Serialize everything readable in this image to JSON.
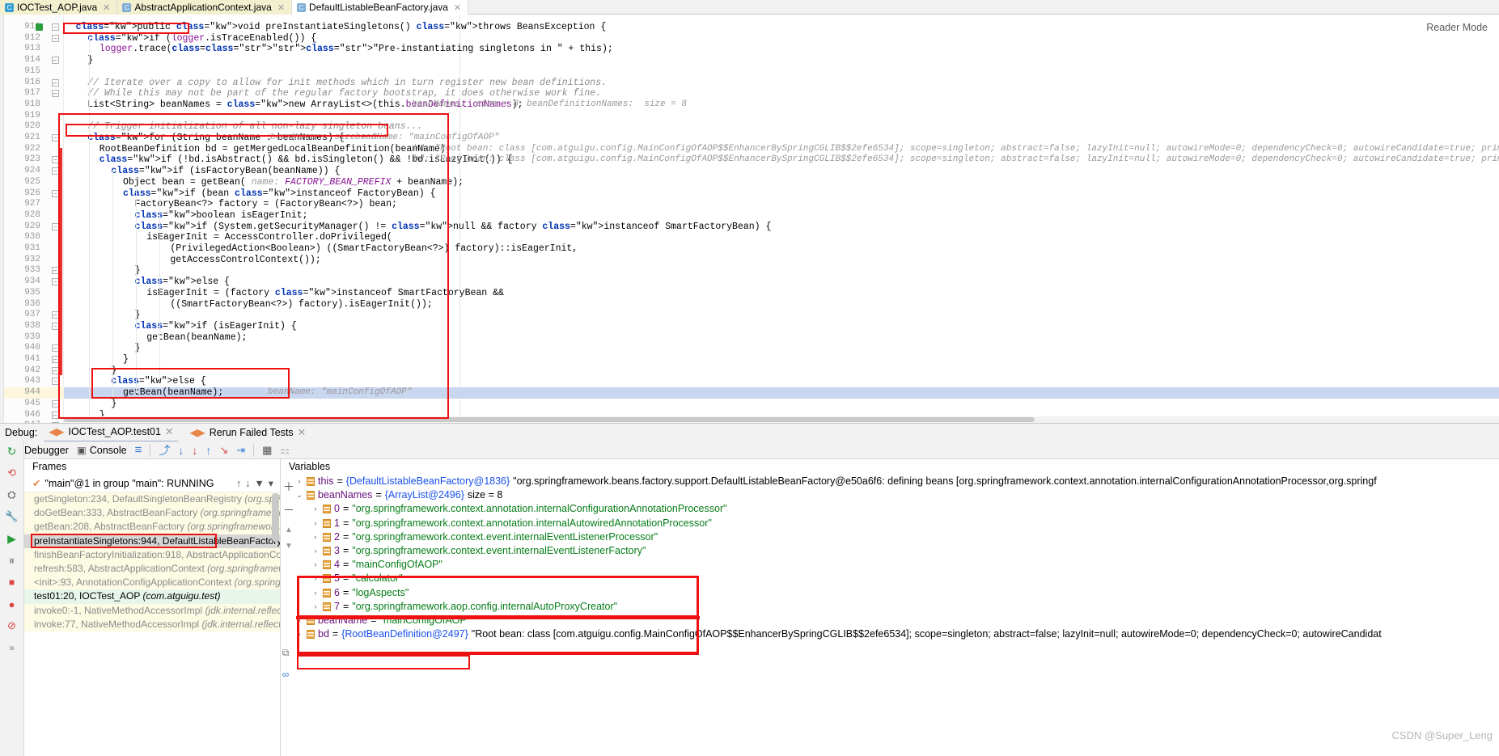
{
  "tabs": [
    {
      "label": "IOCTest_AOP.java",
      "icon": "java-class-icon",
      "state": "active-yellow"
    },
    {
      "label": "AbstractApplicationContext.java",
      "icon": "java-class-library-icon",
      "state": "active-yellow"
    },
    {
      "label": "DefaultListableBeanFactory.java",
      "icon": "java-class-library-icon",
      "state": "active-white"
    }
  ],
  "editor": {
    "reader_mode_label": "Reader Mode",
    "current_line": 944,
    "lines": [
      {
        "n": 911,
        "indent": 1,
        "text": "public void preInstantiateSingletons() throws BeansException {"
      },
      {
        "n": 912,
        "indent": 2,
        "text": "if (logger.isTraceEnabled()) {"
      },
      {
        "n": 913,
        "indent": 3,
        "text": "logger.trace(\"Pre-instantiating singletons in \" + this);"
      },
      {
        "n": 914,
        "indent": 2,
        "text": "}"
      },
      {
        "n": 915,
        "indent": 0,
        "text": ""
      },
      {
        "n": 916,
        "indent": 2,
        "text": "// Iterate over a copy to allow for init methods which in turn register new bean definitions."
      },
      {
        "n": 917,
        "indent": 2,
        "text": "// While this may not be part of the regular factory bootstrap, it does otherwise work fine."
      },
      {
        "n": 918,
        "indent": 2,
        "text": "List<String> beanNames = new ArrayList<>(this.beanDefinitionNames);"
      },
      {
        "n": 919,
        "indent": 0,
        "text": ""
      },
      {
        "n": 920,
        "indent": 2,
        "text": "// Trigger initialization of all non-lazy singleton beans..."
      },
      {
        "n": 921,
        "indent": 2,
        "text": "for (String beanName : beanNames) {"
      },
      {
        "n": 922,
        "indent": 3,
        "text": "RootBeanDefinition bd = getMergedLocalBeanDefinition(beanName);"
      },
      {
        "n": 923,
        "indent": 3,
        "text": "if (!bd.isAbstract() && bd.isSingleton() && !bd.isLazyInit()) {"
      },
      {
        "n": 924,
        "indent": 4,
        "text": "if (isFactoryBean(beanName)) {"
      },
      {
        "n": 925,
        "indent": 5,
        "text": "Object bean = getBean( name: FACTORY_BEAN_PREFIX + beanName);"
      },
      {
        "n": 926,
        "indent": 5,
        "text": "if (bean instanceof FactoryBean) {"
      },
      {
        "n": 927,
        "indent": 6,
        "text": "FactoryBean<?> factory = (FactoryBean<?>) bean;"
      },
      {
        "n": 928,
        "indent": 6,
        "text": "boolean isEagerInit;"
      },
      {
        "n": 929,
        "indent": 6,
        "text": "if (System.getSecurityManager() != null && factory instanceof SmartFactoryBean) {"
      },
      {
        "n": 930,
        "indent": 7,
        "text": "isEagerInit = AccessController.doPrivileged("
      },
      {
        "n": 931,
        "indent": 9,
        "text": "(PrivilegedAction<Boolean>) ((SmartFactoryBean<?>) factory)::isEagerInit,"
      },
      {
        "n": 932,
        "indent": 9,
        "text": "getAccessControlContext());"
      },
      {
        "n": 933,
        "indent": 6,
        "text": "}"
      },
      {
        "n": 934,
        "indent": 6,
        "text": "else {"
      },
      {
        "n": 935,
        "indent": 7,
        "text": "isEagerInit = (factory instanceof SmartFactoryBean &&"
      },
      {
        "n": 936,
        "indent": 9,
        "text": "((SmartFactoryBean<?>) factory).isEagerInit());"
      },
      {
        "n": 937,
        "indent": 6,
        "text": "}"
      },
      {
        "n": 938,
        "indent": 6,
        "text": "if (isEagerInit) {"
      },
      {
        "n": 939,
        "indent": 7,
        "text": "getBean(beanName);"
      },
      {
        "n": 940,
        "indent": 6,
        "text": "}"
      },
      {
        "n": 941,
        "indent": 5,
        "text": "}"
      },
      {
        "n": 942,
        "indent": 4,
        "text": "}"
      },
      {
        "n": 943,
        "indent": 4,
        "text": "else {"
      },
      {
        "n": 944,
        "indent": 5,
        "text": "getBean(beanName);"
      },
      {
        "n": 945,
        "indent": 4,
        "text": "}"
      },
      {
        "n": 946,
        "indent": 3,
        "text": "}"
      },
      {
        "n": 947,
        "indent": 2,
        "text": "}"
      }
    ],
    "inline_hints": {
      "line918_a": "beanNames:  size = 8",
      "line918_b": "beanDefinitionNames:  size = 8",
      "line921_a": "beanNames:  size = 8",
      "line921_b": "beanName: \"mainConfigOfAOP\"",
      "line922": "bd: \"Root bean: class [com.atguigu.config.MainConfigOfAOP$$EnhancerBySpringCGLIB$$2efe6534]; scope=singleton; abstract=false; lazyInit=null; autowireMode=0; dependencyCheck=0; autowireCandidate=true; primary=false; factoryBeanName=null; factoryMethodName=null; initMethodName=nul",
      "line923": "bd: \"Root bean: class [com.atguigu.config.MainConfigOfAOP$$EnhancerBySpringCGLIB$$2efe6534]; scope=singleton; abstract=false; lazyInit=null; autowireMode=0; dependencyCheck=0; autowireCandidate=true; primary=false; factoryBeanName=null; factoryMethodName=null; initMethodName=nul",
      "line944": "beanName: \"mainConfigOfAOP\""
    }
  },
  "debug": {
    "label": "Debug:",
    "tabs": [
      {
        "label": "IOCTest_AOP.test01",
        "selected": true
      },
      {
        "label": "Rerun Failed Tests",
        "selected": false
      }
    ],
    "toolbar": [
      {
        "label": "Debugger",
        "name": "debugger-tab"
      },
      {
        "label": "Console",
        "name": "console-tab"
      }
    ],
    "frames": {
      "title": "Frames",
      "thread": "\"main\"@1 in group \"main\": RUNNING",
      "rows": [
        {
          "method": "getSingleton:234, DefaultSingletonBeanRegistry ",
          "pkg": "(org.springfr",
          "kind": "lib"
        },
        {
          "method": "doGetBean:333, AbstractBeanFactory ",
          "pkg": "(org.springframework.",
          "kind": "lib"
        },
        {
          "method": "getBean:208, AbstractBeanFactory ",
          "pkg": "(org.springframework.bea",
          "kind": "lib"
        },
        {
          "method": "preInstantiateSingletons:944, DefaultListableBeanFactory ",
          "pkg": "(org",
          "kind": "sel"
        },
        {
          "method": "finishBeanFactoryInitialization:918, AbstractApplicationContex",
          "pkg": "",
          "kind": "lib"
        },
        {
          "method": "refresh:583, AbstractApplicationContext ",
          "pkg": "(org.springframework",
          "kind": "lib"
        },
        {
          "method": "<init>:93, AnnotationConfigApplicationContext ",
          "pkg": "(org.springfra",
          "kind": "lib"
        },
        {
          "method": "test01:20, IOCTest_AOP ",
          "pkg": "(com.atguigu.test)",
          "kind": "own"
        },
        {
          "method": "invoke0:-1, NativeMethodAccessorImpl ",
          "pkg": "(jdk.internal.reflect)",
          "kind": "lib"
        },
        {
          "method": "invoke:77, NativeMethodAccessorImpl ",
          "pkg": "(jdk.internal.reflect)",
          "kind": "lib"
        }
      ]
    },
    "variables": {
      "title": "Variables",
      "rows": [
        {
          "indent": 0,
          "expander": ">",
          "name": "this",
          "eq": "=",
          "ref": "{DefaultListableBeanFactory@1836}",
          "value": "\"org.springframework.beans.factory.support.DefaultListableBeanFactory@e50a6f6: defining beans [org.springframework.context.annotation.internalConfigurationAnnotationProcessor,org.springf",
          "vtype": "plain"
        },
        {
          "indent": 0,
          "expander": "v",
          "name": "beanNames",
          "eq": "=",
          "ref": "{ArrayList@2496}",
          "value": "size = 8",
          "vtype": "plain"
        },
        {
          "indent": 1,
          "expander": ">",
          "name": "0",
          "eq": "=",
          "ref": "",
          "value": "\"org.springframework.context.annotation.internalConfigurationAnnotationProcessor\"",
          "vtype": "string"
        },
        {
          "indent": 1,
          "expander": ">",
          "name": "1",
          "eq": "=",
          "ref": "",
          "value": "\"org.springframework.context.annotation.internalAutowiredAnnotationProcessor\"",
          "vtype": "string"
        },
        {
          "indent": 1,
          "expander": ">",
          "name": "2",
          "eq": "=",
          "ref": "",
          "value": "\"org.springframework.context.event.internalEventListenerProcessor\"",
          "vtype": "string"
        },
        {
          "indent": 1,
          "expander": ">",
          "name": "3",
          "eq": "=",
          "ref": "",
          "value": "\"org.springframework.context.event.internalEventListenerFactory\"",
          "vtype": "string"
        },
        {
          "indent": 1,
          "expander": ">",
          "name": "4",
          "eq": "=",
          "ref": "",
          "value": "\"mainConfigOfAOP\"",
          "vtype": "string"
        },
        {
          "indent": 1,
          "expander": ">",
          "name": "5",
          "eq": "=",
          "ref": "",
          "value": "\"calculator\"",
          "vtype": "string"
        },
        {
          "indent": 1,
          "expander": ">",
          "name": "6",
          "eq": "=",
          "ref": "",
          "value": "\"logAspects\"",
          "vtype": "string"
        },
        {
          "indent": 1,
          "expander": ">",
          "name": "7",
          "eq": "=",
          "ref": "",
          "value": "\"org.springframework.aop.config.internalAutoProxyCreator\"",
          "vtype": "string"
        },
        {
          "indent": 0,
          "expander": ">",
          "name": "beanName",
          "eq": "=",
          "ref": "",
          "value": "\"mainConfigOfAOP\"",
          "vtype": "string"
        },
        {
          "indent": 0,
          "expander": ">",
          "name": "bd",
          "eq": "=",
          "ref": "{RootBeanDefinition@2497}",
          "value": "\"Root bean: class [com.atguigu.config.MainConfigOfAOP$$EnhancerBySpringCGLIB$$2efe6534]; scope=singleton; abstract=false; lazyInit=null; autowireMode=0; dependencyCheck=0; autowireCandidat",
          "vtype": "plain"
        }
      ]
    }
  },
  "watermark": "CSDN @Super_Leng",
  "colors": {
    "annotation_red": "#ee1111",
    "exec_line_red": "#ec2f2f",
    "current_line_blue": "#c9d6f0",
    "keyword_blue": "#0033b3",
    "string_green": "#067d17",
    "comment_gray": "#8c8c8c",
    "field_purple": "#871094"
  }
}
